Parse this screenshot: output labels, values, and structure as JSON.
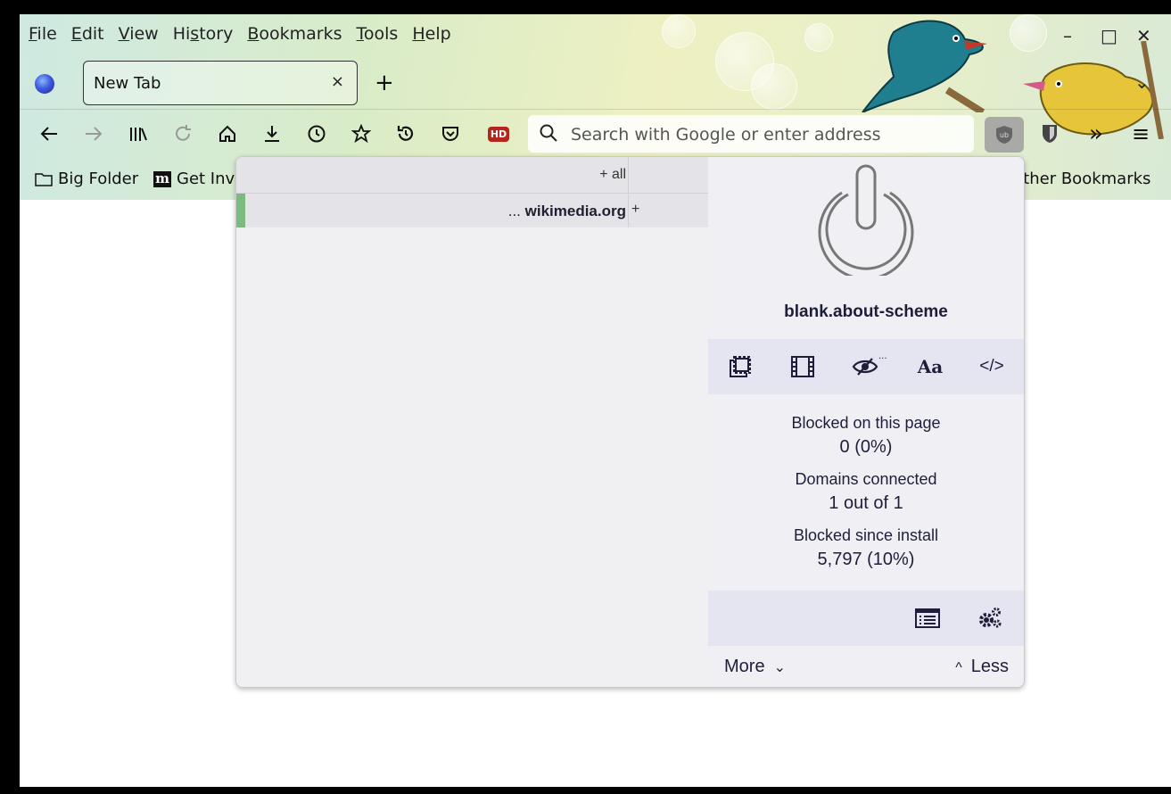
{
  "menubar": {
    "items": [
      {
        "label": "File",
        "accel": "F",
        "rest": "ile"
      },
      {
        "label": "Edit",
        "accel": "E",
        "rest": "dit"
      },
      {
        "label": "View",
        "accel": "V",
        "rest": "iew"
      },
      {
        "label": "History",
        "pre": "Hi",
        "accel": "s",
        "rest": "tory"
      },
      {
        "label": "Bookmarks",
        "accel": "B",
        "rest": "ookmarks"
      },
      {
        "label": "Tools",
        "accel": "T",
        "rest": "ools"
      },
      {
        "label": "Help",
        "accel": "H",
        "rest": "elp"
      }
    ]
  },
  "tabs": [
    {
      "title": "New Tab",
      "close": "×"
    }
  ],
  "new_tab_symbol": "+",
  "window_controls": {
    "minimize": "–",
    "maximize": "□",
    "close": "✕"
  },
  "toolbar": {
    "url_placeholder": "Search with Google or enter address",
    "hd_badge": "HD",
    "overflow": "»",
    "menu": "≡",
    "icons": [
      "back-icon",
      "forward-icon",
      "library-icon",
      "reload-icon",
      "home-icon",
      "downloads-icon",
      "history-icon",
      "bookmarks-star-icon",
      "undo-close-icon",
      "pocket-icon",
      "hd-icon"
    ]
  },
  "bookmarks_bar": {
    "items": [
      {
        "label": "Big Folder",
        "icon": "folder-icon"
      },
      {
        "label": "Get Inv",
        "icon": "m-site-icon",
        "icon_text": "m"
      }
    ],
    "other": "Other Bookmarks"
  },
  "ublock_popup": {
    "firewall": {
      "all_row": "+ all",
      "domain_prefix": "... ",
      "domain": "wikimedia.org",
      "domain_plus": "+"
    },
    "hostname": "blank.about-scheme",
    "tools": [
      "popup-blocking-icon",
      "media-blocking-icon",
      "cosmetic-filtering-icon",
      "fonts-icon",
      "scripts-icon"
    ],
    "fonts_tool_text": "Aa",
    "scripts_tool_text": "</>",
    "stats": [
      {
        "label": "Blocked on this page",
        "value": "0 (0%)"
      },
      {
        "label": "Domains connected",
        "value": "1 out of 1"
      },
      {
        "label": "Blocked since install",
        "value": "5,797 (10%)"
      }
    ],
    "footer": {
      "more": "More",
      "less": "Less",
      "more_chevron": "⌄",
      "less_chevron": "^"
    }
  }
}
